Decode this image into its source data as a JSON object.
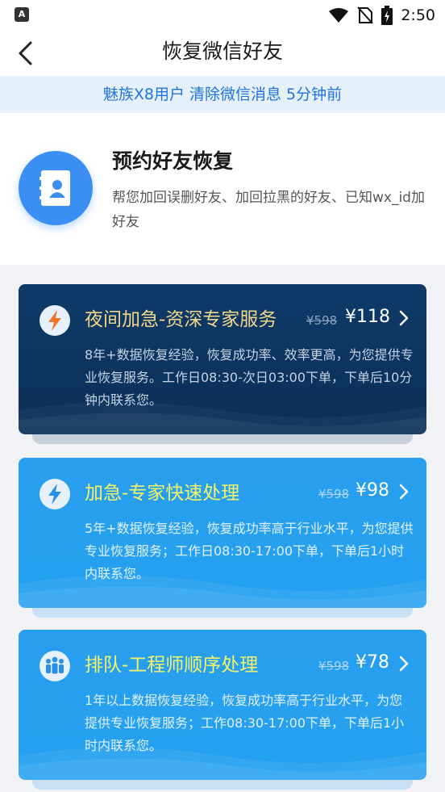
{
  "status_bar": {
    "app_icon_letter": "A",
    "time": "2:50"
  },
  "nav": {
    "title": "恢复微信好友"
  },
  "notice": {
    "text": "魅族X8用户 清除微信消息 5分钟前"
  },
  "intro": {
    "title": "预约好友恢复",
    "description": "帮您加回误删好友、加回拉黑的好友、已知wx_id加好友"
  },
  "services": [
    {
      "title": "夜间加急-资深专家服务",
      "original_price": "¥598",
      "price": "¥118",
      "description": "8年+数据恢复经验，恢复成功率、效率更高，为您提供专业恢复服务。工作日08:30-次日03:00下单，下单后10分钟内联系您。",
      "icon": "lightning-icon"
    },
    {
      "title": "加急-专家快速处理",
      "original_price": "¥598",
      "price": "¥98",
      "description": "5年+数据恢复经验，恢复成功率高于行业水平，为您提供专业恢复服务；工作日08:30-17:00下单，下单后1小时内联系您。",
      "icon": "lightning-icon"
    },
    {
      "title": "排队-工程师顺序处理",
      "original_price": "¥598",
      "price": "¥78",
      "description": "1年以上数据恢复经验，恢复成功率高于行业水平，为您提供专业恢复服务；工作08:30-17:00下单，下单后1小时内联系您。",
      "icon": "people-icon"
    }
  ],
  "colors": {
    "primary_blue": "#3b8ff3",
    "notice_text": "#1f74e0",
    "night_card": "#0f3a68",
    "express_card": "#2a9eee",
    "night_title": "#f2d78a",
    "express_title": "#f3f36a",
    "lightning_orange": "#f0772a",
    "lightning_blue": "#2a8fe8"
  }
}
